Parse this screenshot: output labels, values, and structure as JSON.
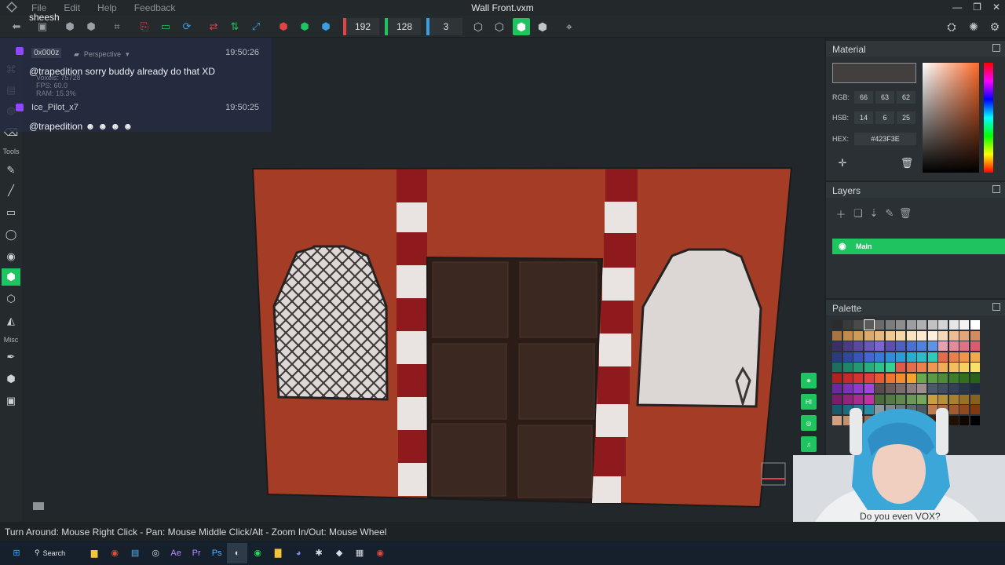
{
  "window": {
    "title": "Wall Front.vxm"
  },
  "menu": [
    "File",
    "Edit",
    "Help",
    "Feedback"
  ],
  "toolbar": {
    "color_values": [
      {
        "value": "192",
        "color": "#e04444"
      },
      {
        "value": "128",
        "color": "#1fc35f"
      },
      {
        "value": "3",
        "color": "#3a9fe0"
      }
    ]
  },
  "chat": {
    "top_user": "sheesh",
    "messages": [
      {
        "user": "",
        "time": "19:50:26",
        "text": "@trapedition sorry buddy already do that XD"
      },
      {
        "user": "Ice_Pilot_x7",
        "time": "19:50:25",
        "text": "@trapedition"
      }
    ],
    "stats": [
      "Voxels: 75728",
      "FPS: 60.0",
      "RAM: 15.3%"
    ]
  },
  "viewport": {
    "coord": "0x000z",
    "mode": "Perspective",
    "left_sections": [
      "Tools",
      "Misc"
    ]
  },
  "material": {
    "header": "Material",
    "rgb_label": "RGB:",
    "rgb": [
      "66",
      "63",
      "62"
    ],
    "hsb_label": "HSB:",
    "hsb": [
      "14",
      "6",
      "25"
    ],
    "hex_label": "HEX:",
    "hex": "#423F3E",
    "current_color": "#423F3E"
  },
  "layers": {
    "header": "Layers",
    "items": [
      "Main"
    ]
  },
  "palette": {
    "header": "Palette"
  },
  "status": {
    "hint": "Turn Around: Mouse Right Click - Pan: Mouse Middle Click/Alt - Zoom In/Out: Mouse Wheel"
  },
  "taskbar": {
    "search_label": "Search"
  },
  "webcam": {
    "shirt_text": "Do you even VOX?"
  }
}
